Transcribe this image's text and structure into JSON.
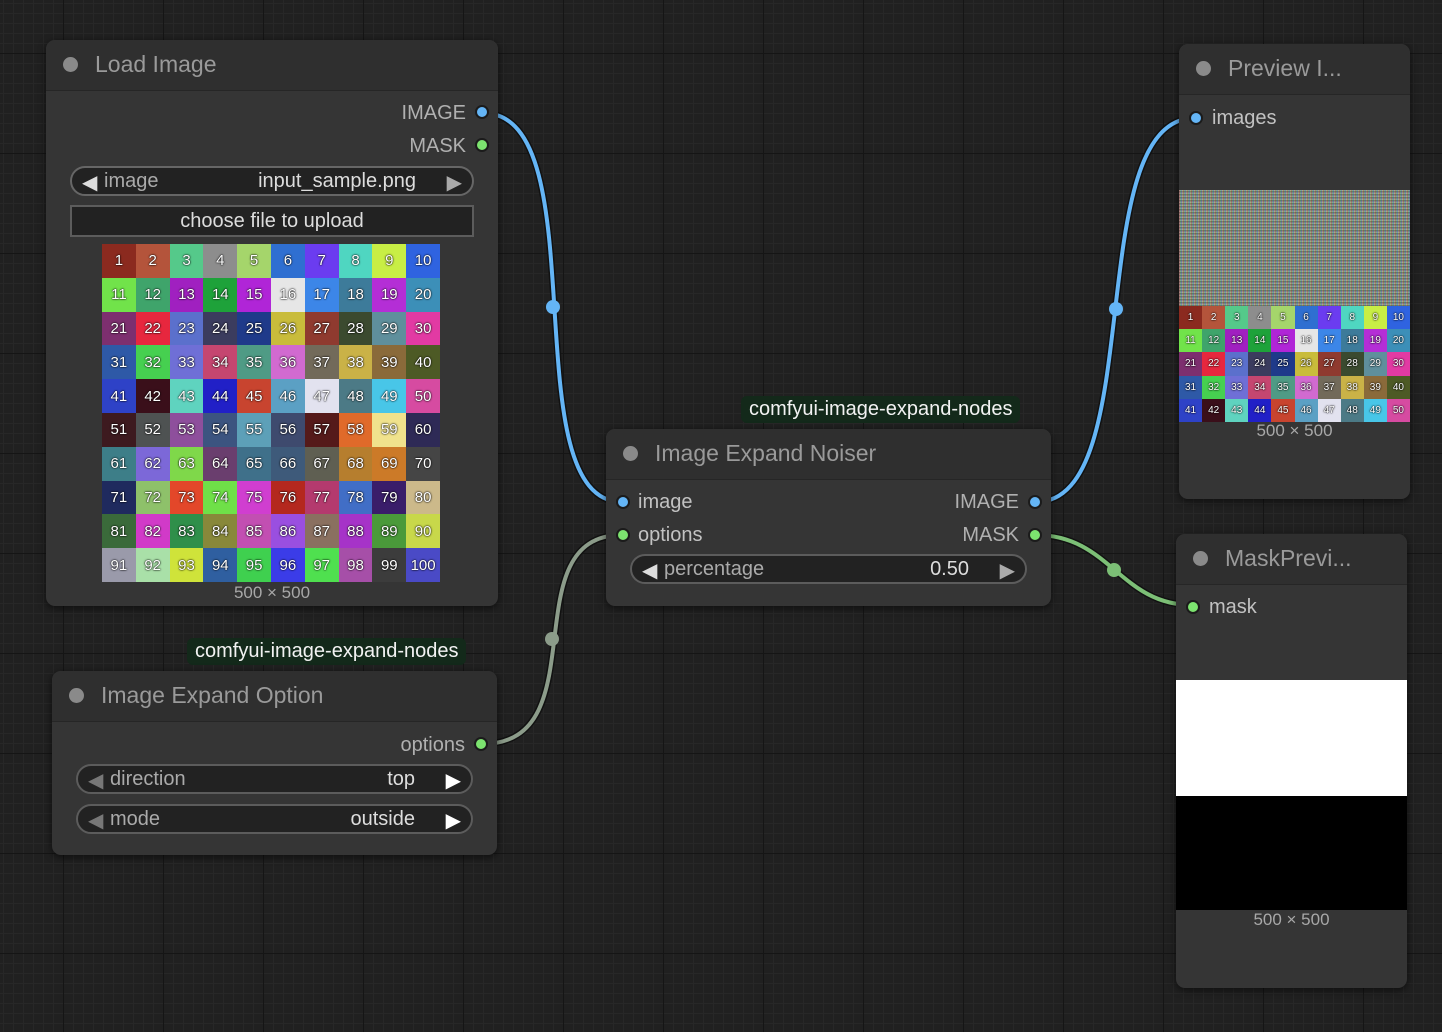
{
  "load_image": {
    "title": "Load Image",
    "outputs": [
      "IMAGE",
      "MASK"
    ],
    "widget_label": "image",
    "widget_value": "input_sample.png",
    "upload_button": "choose file to upload",
    "dimensions": "500 × 500"
  },
  "noiser": {
    "badge": "comfyui-image-expand-nodes",
    "title": "Image Expand Noiser",
    "inputs": [
      "image",
      "options"
    ],
    "outputs": [
      "IMAGE",
      "MASK"
    ],
    "widget_label": "percentage",
    "widget_value": "0.50"
  },
  "option": {
    "badge": "comfyui-image-expand-nodes",
    "title": "Image Expand Option",
    "output": "options",
    "direction_label": "direction",
    "direction_value": "top",
    "mode_label": "mode",
    "mode_value": "outside"
  },
  "preview": {
    "title": "Preview I...",
    "input": "images",
    "dimensions": "500 × 500"
  },
  "mask_preview": {
    "title": "MaskPrevi...",
    "input": "mask",
    "dimensions": "500 × 500"
  },
  "sample_colors": [
    "#8b2a1f",
    "#b4543b",
    "#55c98a",
    "#8d8d8d",
    "#a5d56b",
    "#2f6fd1",
    "#6b3cf0",
    "#4fd6c1",
    "#c8ee45",
    "#2f63e0",
    "#71e34a",
    "#3fa46b",
    "#a020c0",
    "#1ea23a",
    "#b025d7",
    "#e6e6e6",
    "#3c86e8",
    "#3d7b9a",
    "#b42ed6",
    "#3c8fb8",
    "#7d2f6f",
    "#e7273e",
    "#5b70cc",
    "#3b3c5e",
    "#1f3a8a",
    "#c9bc3b",
    "#8f3a2f",
    "#3b4a2f",
    "#5f8f9c",
    "#e23aa3",
    "#2e59a7",
    "#46d050",
    "#6f6fd6",
    "#c54670",
    "#4f9b85",
    "#d16ad0",
    "#726a5a",
    "#cab247",
    "#8a6a3a",
    "#4d5a25",
    "#2e42c7",
    "#3a0f1a",
    "#5fd3bf",
    "#2120c7",
    "#c8442f",
    "#5ba0c4",
    "#e2e2ef",
    "#4c7a86",
    "#48c6e8",
    "#d64ba1",
    "#3d1a1f",
    "#4e5252",
    "#8e4f9c",
    "#3c5480",
    "#5da0b8",
    "#3e4a6e",
    "#551a1a",
    "#e06a2a",
    "#f0e28c",
    "#2e2a56",
    "#3d7e88",
    "#7c68d8",
    "#7fd84a",
    "#6a3e6e",
    "#3f708a",
    "#3e5a7a",
    "#5f5f52",
    "#b67e2e",
    "#cc7a28",
    "#454545",
    "#1f2a5e",
    "#8ec16a",
    "#e3472a",
    "#6fe048",
    "#d03ed0",
    "#b4281e",
    "#b43a6e",
    "#416ec6",
    "#3a1d6a",
    "#ccb98a",
    "#3a6a3a",
    "#d13ac8",
    "#2f8f4a",
    "#88883a",
    "#c24fb2",
    "#9a4fe0",
    "#8a7060",
    "#a633c8",
    "#4a9a3a",
    "#c8d84a",
    "#9a9aaa",
    "#a9e0a8",
    "#cfe33a",
    "#2f5fa0",
    "#3fd04f",
    "#3b3ce8",
    "#4fe04f",
    "#a64fa8",
    "#3c3c3c",
    "#4a4ac6"
  ]
}
